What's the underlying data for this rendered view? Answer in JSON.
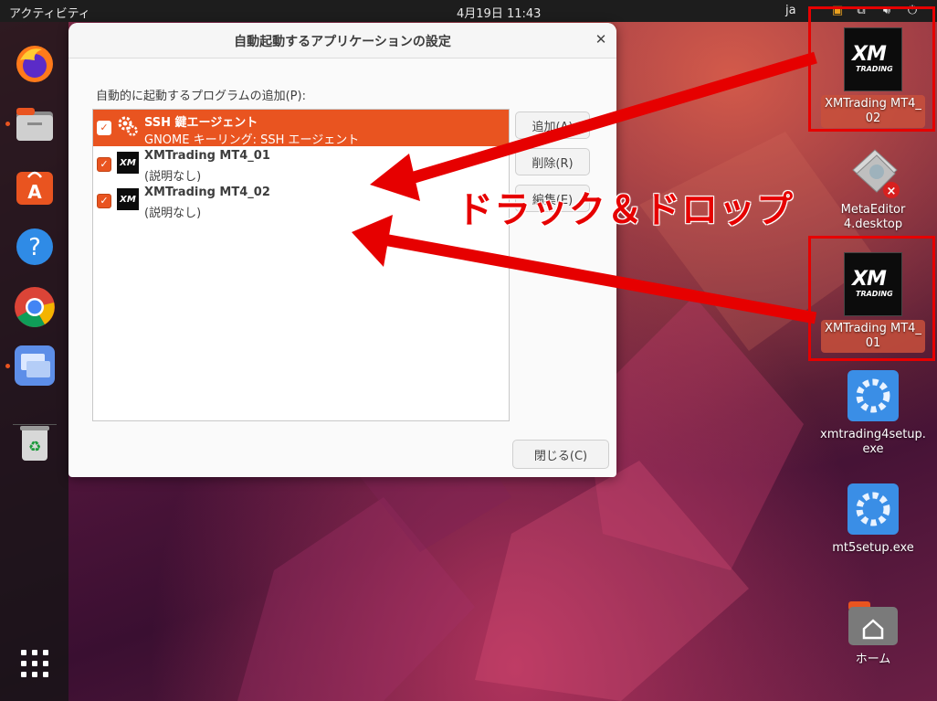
{
  "topbar": {
    "activities": "アクティビティ",
    "clock": "4月19日  11:43",
    "lang": "ja"
  },
  "dialog": {
    "title": "自動起動するアプリケーションの設定",
    "list_label": "自動的に起動するプログラムの追加(P):",
    "items": [
      {
        "title": "SSH 鍵エージェント",
        "subtitle": "GNOME キーリング: SSH エージェント",
        "checked": true,
        "selected": true
      },
      {
        "title": "XMTrading MT4_01",
        "subtitle": "(説明なし)",
        "checked": true,
        "selected": false
      },
      {
        "title": "XMTrading MT4_02",
        "subtitle": "(説明なし)",
        "checked": true,
        "selected": false
      }
    ],
    "buttons": {
      "add": "追加(A)",
      "remove": "削除(R)",
      "edit": "編集(E)",
      "close": "閉じる(C)"
    }
  },
  "desktop_icons": {
    "mt4_02": {
      "line1": "XMTrading MT4_",
      "line2": "02"
    },
    "metaeditor": {
      "line1": "MetaEditor",
      "line2": "4.desktop"
    },
    "mt4_01": {
      "line1": "XMTrading MT4_",
      "line2": "01"
    },
    "xm_setup": {
      "line1": "xmtrading4setup.",
      "line2": "exe"
    },
    "mt5_setup": {
      "line1": "mt5setup.exe"
    },
    "home": {
      "line1": "ホーム"
    }
  },
  "xm_logo": {
    "brand": "XM",
    "tag": "TRADING"
  },
  "annotation": {
    "text": "ドラック＆ドロップ"
  },
  "colors": {
    "accent": "#e95420",
    "annotation_red": "#e60000"
  }
}
